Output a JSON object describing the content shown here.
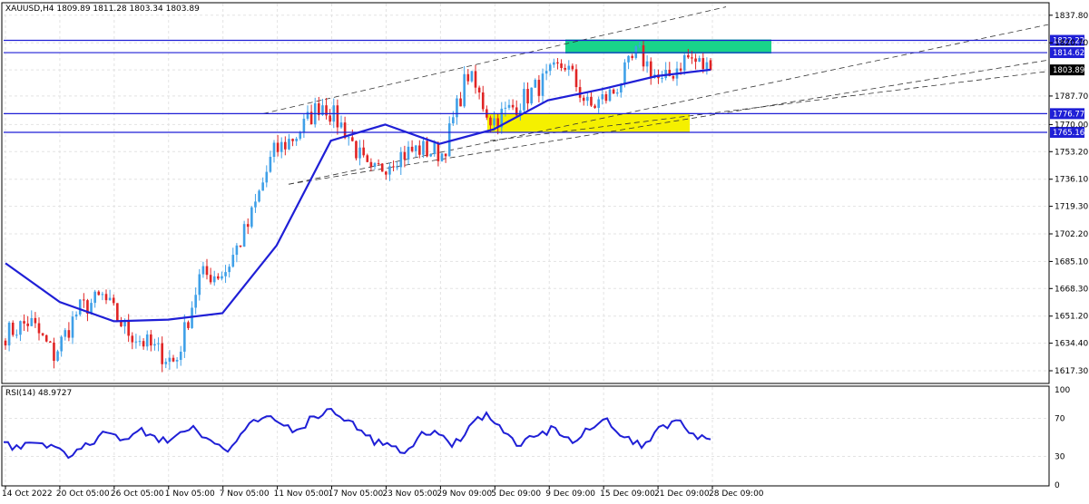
{
  "main_chart": {
    "title": "XAUUSD,H4  1809.89 1811.28 1803.34 1803.89",
    "price_labels": [
      "1837.80",
      "1820.70",
      "1803.89",
      "1787.70",
      "1770.00",
      "1753.20",
      "1736.10",
      "1719.30",
      "1702.20",
      "1685.10",
      "1668.30",
      "1651.20",
      "1634.40",
      "1617.30"
    ],
    "level_tags": [
      "1822.22",
      "1814.62",
      "1776.77",
      "1765.16"
    ],
    "current_price": "1803.89",
    "colors": {
      "level_line": "#1f1fd6",
      "ma_line": "#1f1fd6",
      "up_candle": "#3fa0e8",
      "down_candle": "#e02424",
      "resistance_zone": "#19d38a",
      "support_zone": "#f5f000"
    }
  },
  "rsi_panel": {
    "title": "RSI(14) 48.9727",
    "labels": [
      "100",
      "70",
      "30",
      "0"
    ]
  },
  "time_axis": {
    "labels": [
      "14 Oct 2022",
      "20 Oct 05:00",
      "26 Oct 05:00",
      "1 Nov 05:00",
      "7 Nov 05:00",
      "11 Nov 05:00",
      "17 Nov 05:00",
      "23 Nov 05:00",
      "29 Nov 09:00",
      "5 Dec 09:00",
      "9 Dec 09:00",
      "15 Dec 09:00",
      "21 Dec 09:00",
      "28 Dec 09:00"
    ]
  },
  "chart_data": {
    "type": "candlestick",
    "symbol": "XAUUSD",
    "timeframe": "H4",
    "ohlc_last": {
      "open": 1809.89,
      "high": 1811.28,
      "low": 1803.34,
      "close": 1803.89
    },
    "ylim": [
      1610,
      1845
    ],
    "horizontal_levels": [
      1822.22,
      1814.62,
      1776.77,
      1765.16
    ],
    "resistance_zone": [
      1814.62,
      1822.22
    ],
    "support_zone": [
      1765.16,
      1776.77
    ],
    "close_path": [
      {
        "x": "14 Oct 2022",
        "y": 1640
      },
      {
        "x": "17 Oct",
        "y": 1648
      },
      {
        "x": "20 Oct 05:00",
        "y": 1627
      },
      {
        "x": "22 Oct",
        "y": 1655
      },
      {
        "x": "26 Oct 05:00",
        "y": 1663
      },
      {
        "x": "28 Oct",
        "y": 1642
      },
      {
        "x": "1 Nov 05:00",
        "y": 1632
      },
      {
        "x": "3 Nov",
        "y": 1622
      },
      {
        "x": "5 Nov",
        "y": 1676
      },
      {
        "x": "7 Nov 05:00",
        "y": 1678
      },
      {
        "x": "9 Nov",
        "y": 1708
      },
      {
        "x": "10 Nov",
        "y": 1752
      },
      {
        "x": "11 Nov 05:00",
        "y": 1764
      },
      {
        "x": "15 Nov",
        "y": 1784
      },
      {
        "x": "17 Nov 05:00",
        "y": 1766
      },
      {
        "x": "21 Nov",
        "y": 1738
      },
      {
        "x": "23 Nov 05:00",
        "y": 1750
      },
      {
        "x": "25 Nov",
        "y": 1755
      },
      {
        "x": "29 Nov 09:00",
        "y": 1752
      },
      {
        "x": "1 Dec",
        "y": 1802
      },
      {
        "x": "5 Dec 09:00",
        "y": 1772
      },
      {
        "x": "7 Dec",
        "y": 1782
      },
      {
        "x": "9 Dec 09:00",
        "y": 1795
      },
      {
        "x": "13 Dec",
        "y": 1808
      },
      {
        "x": "15 Dec 09:00",
        "y": 1780
      },
      {
        "x": "19 Dec",
        "y": 1790
      },
      {
        "x": "21 Dec 09:00",
        "y": 1815
      },
      {
        "x": "23 Dec",
        "y": 1795
      },
      {
        "x": "27 Dec",
        "y": 1812
      },
      {
        "x": "28 Dec 09:00",
        "y": 1803.89
      }
    ],
    "moving_average": [
      {
        "x": "14 Oct 2022",
        "y": 1684
      },
      {
        "x": "20 Oct 05:00",
        "y": 1660
      },
      {
        "x": "26 Oct 05:00",
        "y": 1648
      },
      {
        "x": "1 Nov 05:00",
        "y": 1649
      },
      {
        "x": "7 Nov 05:00",
        "y": 1653
      },
      {
        "x": "11 Nov 05:00",
        "y": 1695
      },
      {
        "x": "17 Nov 05:00",
        "y": 1760
      },
      {
        "x": "23 Nov 05:00",
        "y": 1770
      },
      {
        "x": "29 Nov 09:00",
        "y": 1758
      },
      {
        "x": "5 Dec 09:00",
        "y": 1767
      },
      {
        "x": "9 Dec 09:00",
        "y": 1785
      },
      {
        "x": "15 Dec 09:00",
        "y": 1792
      },
      {
        "x": "21 Dec 09:00",
        "y": 1800
      },
      {
        "x": "28 Dec 09:00",
        "y": 1804
      }
    ],
    "rsi": {
      "name": "RSI(14)",
      "last": 48.9727,
      "ylim": [
        0,
        100
      ],
      "levels": [
        70,
        30
      ],
      "values": [
        45,
        38,
        44,
        40,
        31,
        42,
        55,
        48,
        60,
        45,
        52,
        62,
        47,
        35,
        58,
        70,
        65,
        58,
        72,
        80,
        68,
        52,
        42,
        34,
        49,
        57,
        40,
        62,
        76,
        55,
        41,
        52,
        60,
        44,
        58,
        70,
        50,
        39,
        61,
        68,
        54,
        48
      ]
    }
  }
}
